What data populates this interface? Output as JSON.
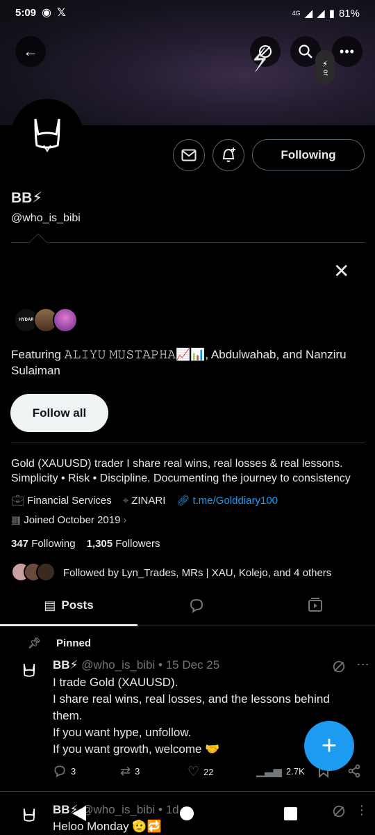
{
  "status": {
    "time": "5:09",
    "network": "4G",
    "battery": "81%"
  },
  "profile": {
    "name": "BB⚡",
    "handle": "@who_is_bibi",
    "following_label": "Following",
    "bio": "Gold (XAUUSD) trader I share real wins, real losses & real lessons. Simplicity • Risk • Discipline. Documenting the journey to consistency",
    "category": "Financial Services",
    "location": "ZINARI",
    "link": "t.me/Golddiary100",
    "joined": "Joined October 2019",
    "following_count": "347",
    "following_text": "Following",
    "followers_count": "1,305",
    "followers_text": "Followers",
    "followed_by": "Followed by Lyn_Trades, MRs | XAU, Kolejo, and 4 others"
  },
  "featuring": {
    "text": "Featuring 𝙰𝙻𝙸𝚈𝚄 𝙼𝚄𝚂𝚃𝙰𝙿𝙷𝙰📈📊, Abdulwahab, and Nanziru Sulaiman",
    "follow_all_label": "Follow all",
    "avatar_logo_text": "HYDAR"
  },
  "tabs": {
    "posts_label": "Posts"
  },
  "pinned_post": {
    "pinned_label": "Pinned",
    "author": "BB⚡",
    "meta": "@who_is_bibi • 15 Dec 25",
    "lines": [
      "I trade Gold (XAUUSD).",
      "I share real wins, real losses, and the lessons behind them.",
      "If you want hype, unfollow.",
      "If you want growth, welcome 🤝"
    ],
    "replies": "3",
    "reposts": "3",
    "likes": "22",
    "views": "2.7K"
  },
  "second_post": {
    "author": "BB⚡",
    "meta": "@who_is_bibi • 1d",
    "text": "Heloo Monday 🫡🔁"
  },
  "colors": {
    "accent": "#1d9bf0",
    "text": "#e7e9ea",
    "muted": "#71767b",
    "border": "#2f3336"
  }
}
